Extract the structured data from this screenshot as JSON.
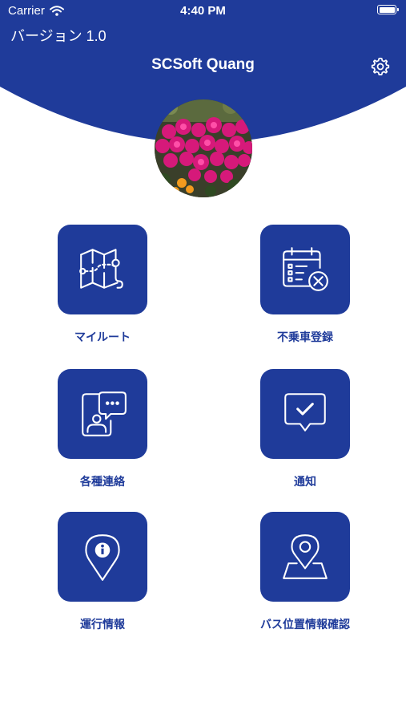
{
  "status_bar": {
    "carrier": "Carrier",
    "time": "4:40 PM"
  },
  "header": {
    "version": "バージョン 1.0",
    "title": "SCSoft Quang"
  },
  "colors": {
    "primary": "#1f3b9a",
    "background": "#ffffff"
  },
  "menu": [
    {
      "label": "マイルート",
      "icon": "map-route-icon"
    },
    {
      "label": "不乗車登録",
      "icon": "calendar-cancel-icon"
    },
    {
      "label": "各種連絡",
      "icon": "contact-chat-icon"
    },
    {
      "label": "通知",
      "icon": "message-check-icon"
    },
    {
      "label": "運行情報",
      "icon": "info-pin-icon"
    },
    {
      "label": "バス位置情報確認",
      "icon": "location-map-icon"
    }
  ]
}
